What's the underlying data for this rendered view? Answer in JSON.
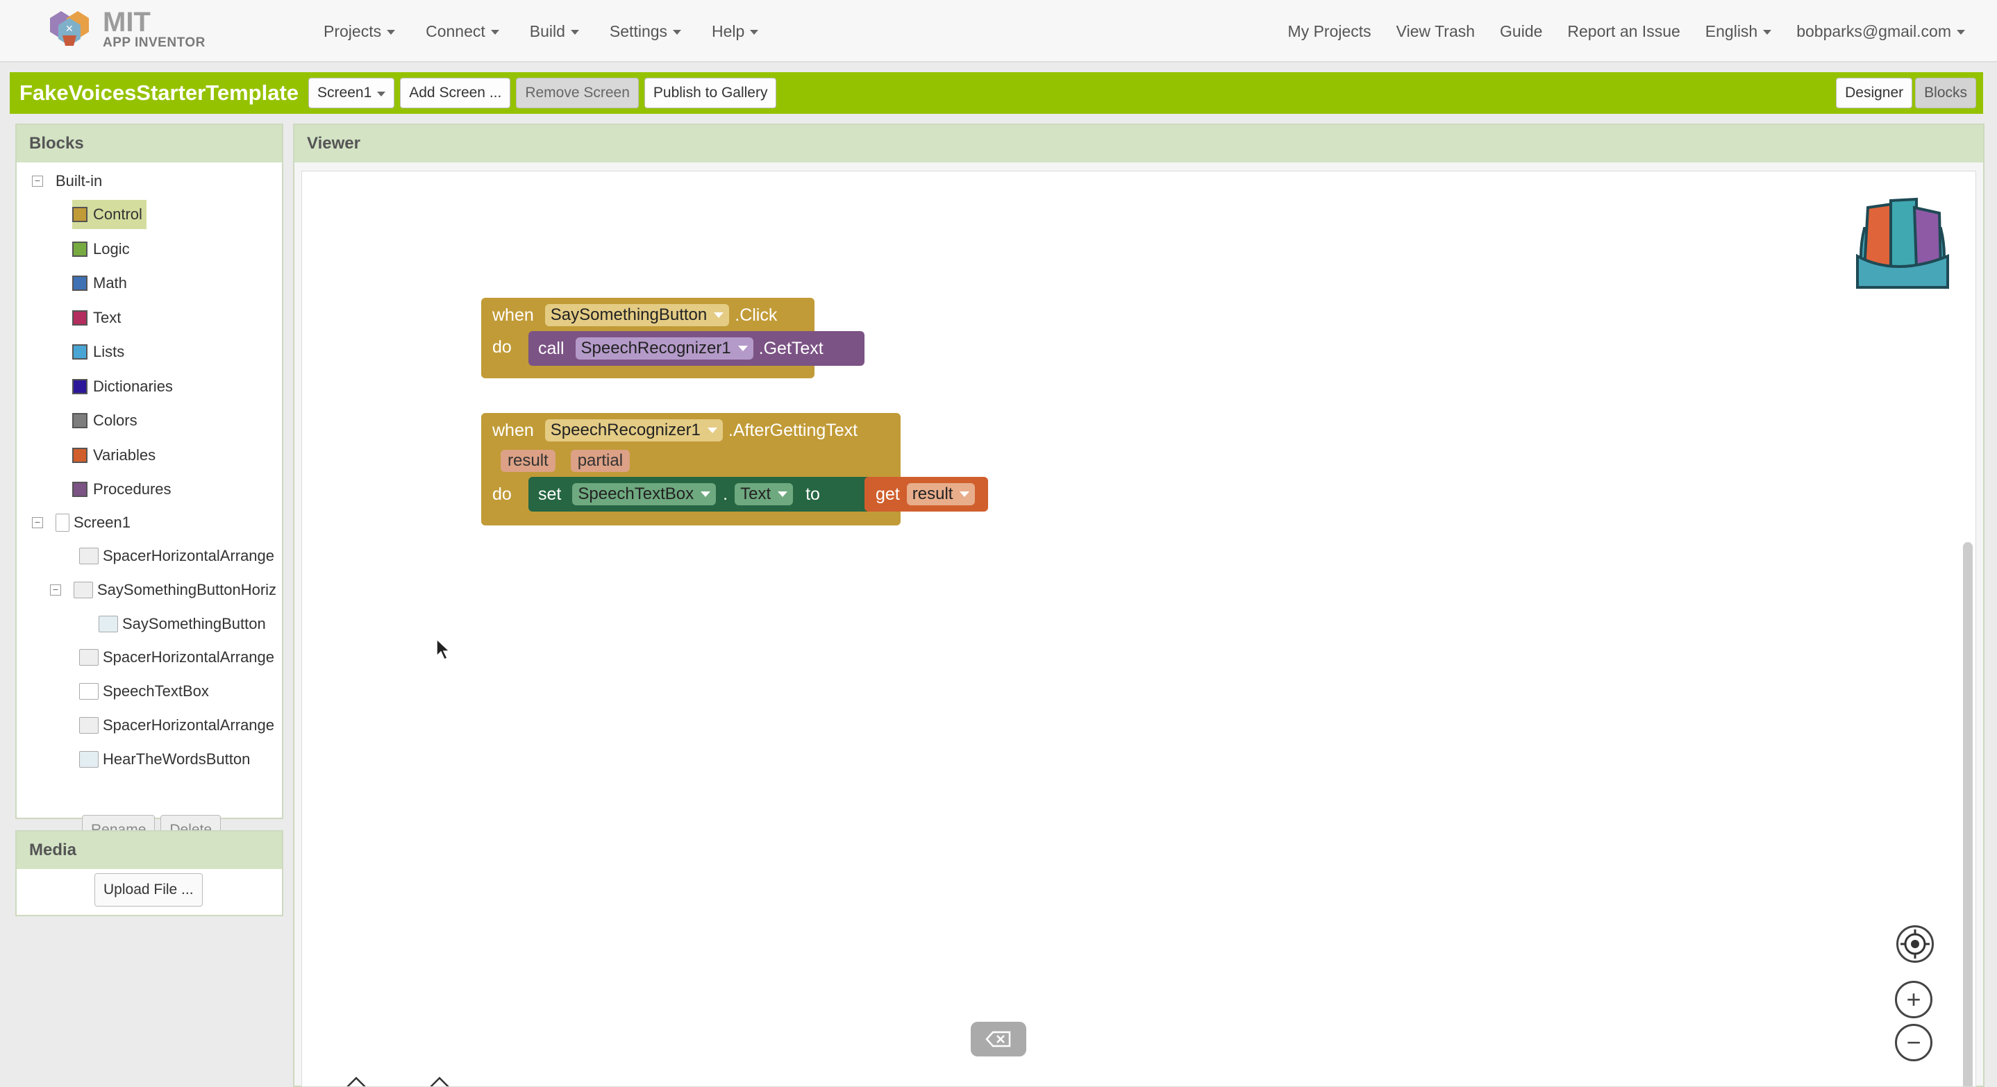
{
  "app": {
    "logo_title": "MIT",
    "logo_subtitle": "APP INVENTOR"
  },
  "nav": {
    "menus": [
      "Projects",
      "Connect",
      "Build",
      "Settings",
      "Help"
    ],
    "right": [
      "My Projects",
      "View Trash",
      "Guide",
      "Report an Issue",
      "English",
      "bobparks@gmail.com"
    ]
  },
  "toolbar": {
    "project_name": "FakeVoicesStarterTemplate",
    "screen_select": "Screen1",
    "add_screen": "Add Screen ...",
    "remove_screen": "Remove Screen",
    "publish": "Publish to Gallery",
    "designer": "Designer",
    "blocks": "Blocks"
  },
  "blocks_panel": {
    "title": "Blocks",
    "builtin_label": "Built-in",
    "builtin": [
      {
        "label": "Control",
        "color": "#c19b37"
      },
      {
        "label": "Logic",
        "color": "#77ab41"
      },
      {
        "label": "Math",
        "color": "#3f71b5"
      },
      {
        "label": "Text",
        "color": "#b32d5e"
      },
      {
        "label": "Lists",
        "color": "#49a6d4"
      },
      {
        "label": "Dictionaries",
        "color": "#2d1799"
      },
      {
        "label": "Colors",
        "color": "#7d7d7d"
      },
      {
        "label": "Variables",
        "color": "#d05f2d"
      },
      {
        "label": "Procedures",
        "color": "#7c5385"
      }
    ],
    "screen_label": "Screen1",
    "components": [
      {
        "label": "SpacerHorizontalArrange",
        "indent": 1,
        "icon": "arrangement-icon"
      },
      {
        "label": "SaySomethingButtonHoriz",
        "indent": 1,
        "icon": "arrangement-icon",
        "expanded": true
      },
      {
        "label": "SaySomethingButton",
        "indent": 2,
        "icon": "button-icon"
      },
      {
        "label": "SpacerHorizontalArrange",
        "indent": 1,
        "icon": "arrangement-icon"
      },
      {
        "label": "SpeechTextBox",
        "indent": 1,
        "icon": "textbox-icon"
      },
      {
        "label": "SpacerHorizontalArrange",
        "indent": 1,
        "icon": "arrangement-icon"
      },
      {
        "label": "HearTheWordsButton",
        "indent": 1,
        "icon": "button-icon"
      }
    ],
    "rename": "Rename",
    "delete": "Delete"
  },
  "media_panel": {
    "title": "Media",
    "upload": "Upload File ..."
  },
  "viewer": {
    "title": "Viewer",
    "block1": {
      "when": "when",
      "component": "SaySomethingButton",
      "event": ".Click",
      "do": "do",
      "call": "call",
      "call_component": "SpeechRecognizer1",
      "method": ".GetText"
    },
    "block2": {
      "when": "when",
      "component": "SpeechRecognizer1",
      "event": ".AfterGettingText",
      "params": [
        "result",
        "partial"
      ],
      "do": "do",
      "set": "set",
      "set_component": "SpeechTextBox",
      "dot": ".",
      "property": "Text",
      "to": "to",
      "get": "get",
      "get_var": "result"
    }
  },
  "colors": {
    "toolbar_green": "#95c200",
    "control_block": "#c19b37",
    "component_block": "#7c5385",
    "set_block": "#266643",
    "get_block": "#d05f2d"
  }
}
